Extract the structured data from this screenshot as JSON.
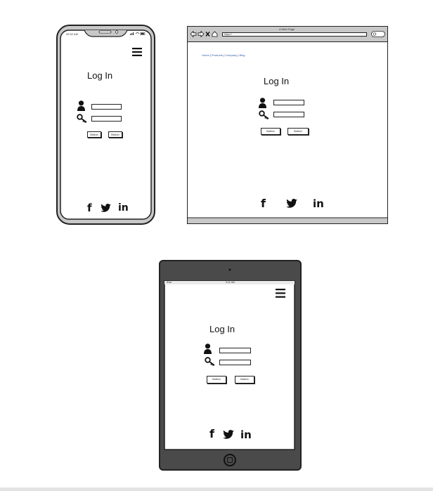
{
  "phone": {
    "status_time": "09:32 AM",
    "title": "Log In",
    "buttons": [
      "Button",
      "Button"
    ],
    "social": {
      "facebook": "f",
      "linkedin": "in"
    }
  },
  "browser": {
    "window_title": "A Web Page",
    "url": "https://",
    "nav": [
      "Home",
      "Products",
      "Company",
      "Blog"
    ],
    "title": "Log In",
    "buttons": [
      "Button",
      "Button"
    ],
    "social": {
      "facebook": "f",
      "linkedin": "in"
    }
  },
  "tablet": {
    "status_left": "iPad",
    "status_time": "9:41 AM",
    "title": "Log In",
    "buttons": [
      "Button",
      "Button"
    ],
    "social": {
      "facebook": "f",
      "linkedin": "in"
    }
  },
  "icons": [
    "user-icon",
    "key-icon",
    "hamburger-menu-icon",
    "twitter-icon",
    "home-button-icon",
    "camera-icon",
    "back-arrow-icon",
    "forward-arrow-icon",
    "close-x-icon",
    "home-icon",
    "search-icon"
  ],
  "colors": {
    "device_frame": "#c8c8c8",
    "tablet_body": "#4a4a4a",
    "link": "#2a5db0"
  }
}
